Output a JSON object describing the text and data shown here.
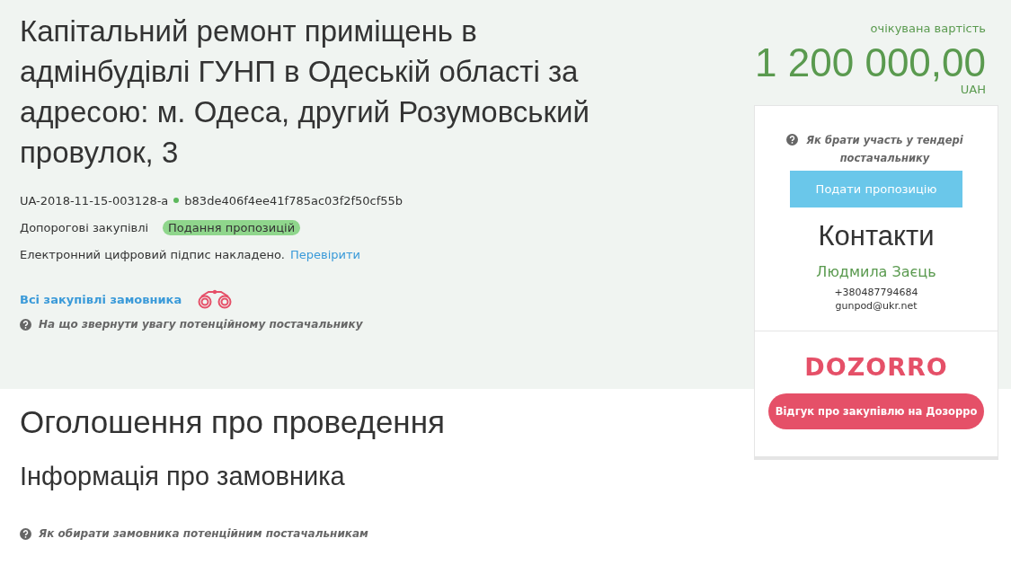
{
  "tender": {
    "title": "Капітальний ремонт приміщень в адмінбудівлі ГУНП в Одеській області за адресою: м. Одеса, другий Розумовський провулок, 3",
    "tender_id": "UA-2018-11-15-003128-a",
    "hash": "b83de406f4ee41f785ac03f2f50cf55b",
    "procedure": "Допорогові закупівлі",
    "status": "Подання пропозицій",
    "signature_text": "Електронний цифровий підпис накладено.",
    "signature_link": "Перевірити",
    "buyer_link": "Всі закупівлі замовника",
    "hint": "На що звернути увагу потенційному постачальнику"
  },
  "value": {
    "label": "очікувана вартість",
    "amount": "1 200 000,00",
    "currency": "UAH"
  },
  "sidebar": {
    "hint": "Як брати участь у тендері постачальнику",
    "submit_button": "Подати пропозицію",
    "contacts_title": "Контакти",
    "contact_name": "Людмила Заєць",
    "phone": "+380487794684",
    "email": "gunpod@ukr.net",
    "logo": "DOZORRO",
    "feedback_button": "Відгук про закупівлю на Дозорро"
  },
  "sections": {
    "heading": "Оголошення про проведення",
    "subheading": "Інформація про замовника",
    "hint": "Як обирати замовника потенційним постачальникам"
  }
}
